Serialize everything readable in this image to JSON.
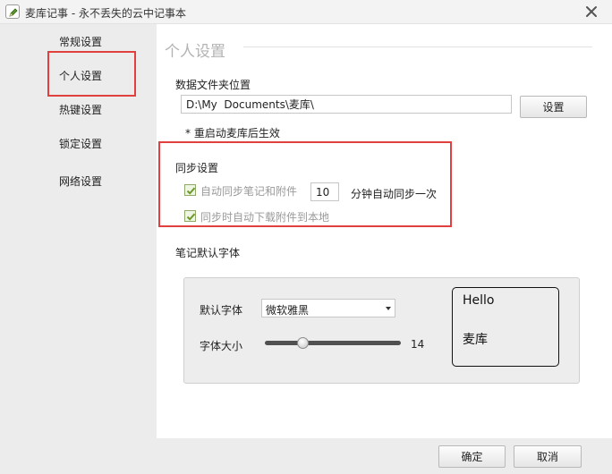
{
  "window": {
    "title": "麦库记事 - 永不丢失的云中记事本",
    "icon": "pencil-note-icon",
    "close_icon": "close-x-icon"
  },
  "sidebar": {
    "items": [
      {
        "label": "常规设置",
        "selected": false
      },
      {
        "label": "个人设置",
        "selected": true
      },
      {
        "label": "热键设置",
        "selected": false
      },
      {
        "label": "锁定设置",
        "selected": false
      },
      {
        "label": "网络设置",
        "selected": false
      }
    ]
  },
  "main": {
    "section_title": "个人设置",
    "data_folder": {
      "label": "数据文件夹位置",
      "value": "D:\\My  Documents\\麦库\\",
      "button_label": "设置",
      "note": "* 重启动麦库后生效"
    },
    "sync": {
      "heading": "同步设置",
      "auto_sync_label": "自动同步笔记和附件",
      "auto_sync_checked": true,
      "interval_value": "10",
      "interval_suffix": "分钟自动同步一次",
      "download_attachments_label": "同步时自动下载附件到本地",
      "download_attachments_checked": true
    },
    "font": {
      "heading": "笔记默认字体",
      "default_font_label": "默认字体",
      "default_font_value": "微软雅黑",
      "font_size_label": "字体大小",
      "font_size_value": "14",
      "font_size_slider_fraction": 0.28,
      "preview_line1": "Hello",
      "preview_line2": "麦库"
    }
  },
  "footer": {
    "ok_label": "确定",
    "cancel_label": "取消"
  },
  "colors": {
    "highlight_red": "#e0413f",
    "sidebar_bg": "#ececec",
    "check_green": "#6e9a2d"
  }
}
